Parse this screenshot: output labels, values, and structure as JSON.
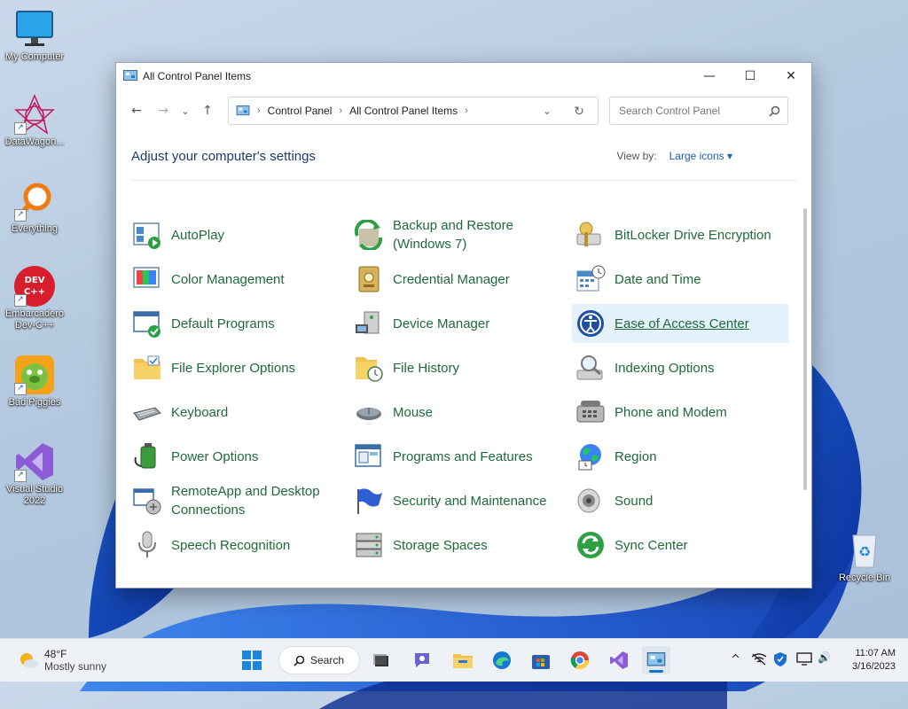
{
  "desktop": {
    "icons": [
      {
        "label": "My Computer"
      },
      {
        "label": "DataWagon..."
      },
      {
        "label": "Everything"
      },
      {
        "label": "Embarcadero Dev-C++"
      },
      {
        "label": "Bad Piggies"
      },
      {
        "label": "Visual Studio 2022"
      },
      {
        "label": "Recycle Bin"
      }
    ],
    "devcpp_glyph": "DEV C++"
  },
  "window": {
    "title": "All Control Panel Items",
    "controls": {
      "minimize": "—",
      "maximize": "☐",
      "close": "✕"
    },
    "nav": {
      "back": "←",
      "forward": "→",
      "recent": "⌄",
      "up": "↑"
    },
    "address": {
      "crumbs": [
        "Control Panel",
        "All Control Panel Items"
      ],
      "separator": "›",
      "dropdown": "⌄",
      "refresh": "↻"
    },
    "search": {
      "placeholder": "Search Control Panel"
    },
    "heading": "Adjust your computer's settings",
    "view_by_label": "View by:",
    "view_by_value": "Large icons ▾"
  },
  "items": [
    {
      "label": "AutoPlay",
      "icon": "autoplay-icon"
    },
    {
      "label": "Backup and Restore (Windows 7)",
      "icon": "backup-restore-icon"
    },
    {
      "label": "BitLocker Drive Encryption",
      "icon": "bitlocker-icon"
    },
    {
      "label": "Color Management",
      "icon": "color-management-icon"
    },
    {
      "label": "Credential Manager",
      "icon": "credential-manager-icon"
    },
    {
      "label": "Date and Time",
      "icon": "date-time-icon"
    },
    {
      "label": "Default Programs",
      "icon": "default-programs-icon"
    },
    {
      "label": "Device Manager",
      "icon": "device-manager-icon"
    },
    {
      "label": "Ease of Access Center",
      "icon": "ease-of-access-icon"
    },
    {
      "label": "File Explorer Options",
      "icon": "folder-options-icon"
    },
    {
      "label": "File History",
      "icon": "file-history-icon"
    },
    {
      "label": "Indexing Options",
      "icon": "indexing-icon"
    },
    {
      "label": "Keyboard",
      "icon": "keyboard-icon"
    },
    {
      "label": "Mouse",
      "icon": "mouse-icon"
    },
    {
      "label": "Phone and Modem",
      "icon": "phone-modem-icon"
    },
    {
      "label": "Power Options",
      "icon": "power-options-icon"
    },
    {
      "label": "Programs and Features",
      "icon": "programs-features-icon"
    },
    {
      "label": "Region",
      "icon": "region-icon"
    },
    {
      "label": "RemoteApp and Desktop Connections",
      "icon": "remoteapp-icon"
    },
    {
      "label": "Security and Maintenance",
      "icon": "security-flag-icon"
    },
    {
      "label": "Sound",
      "icon": "sound-icon"
    },
    {
      "label": "Speech Recognition",
      "icon": "microphone-icon"
    },
    {
      "label": "Storage Spaces",
      "icon": "storage-spaces-icon"
    },
    {
      "label": "Sync Center",
      "icon": "sync-center-icon"
    }
  ],
  "taskbar": {
    "weather_temp": "48°F",
    "weather_desc": "Mostly sunny",
    "search_label": "Search",
    "clock_time": "11:07 AM",
    "clock_date": "3/16/2023",
    "tray": {
      "chevron": "^",
      "volume": "🔊"
    }
  },
  "colors": {
    "link_green": "#1f6a3a",
    "heading_blue": "#1e3a6e",
    "accent": "#1a6fd0"
  }
}
